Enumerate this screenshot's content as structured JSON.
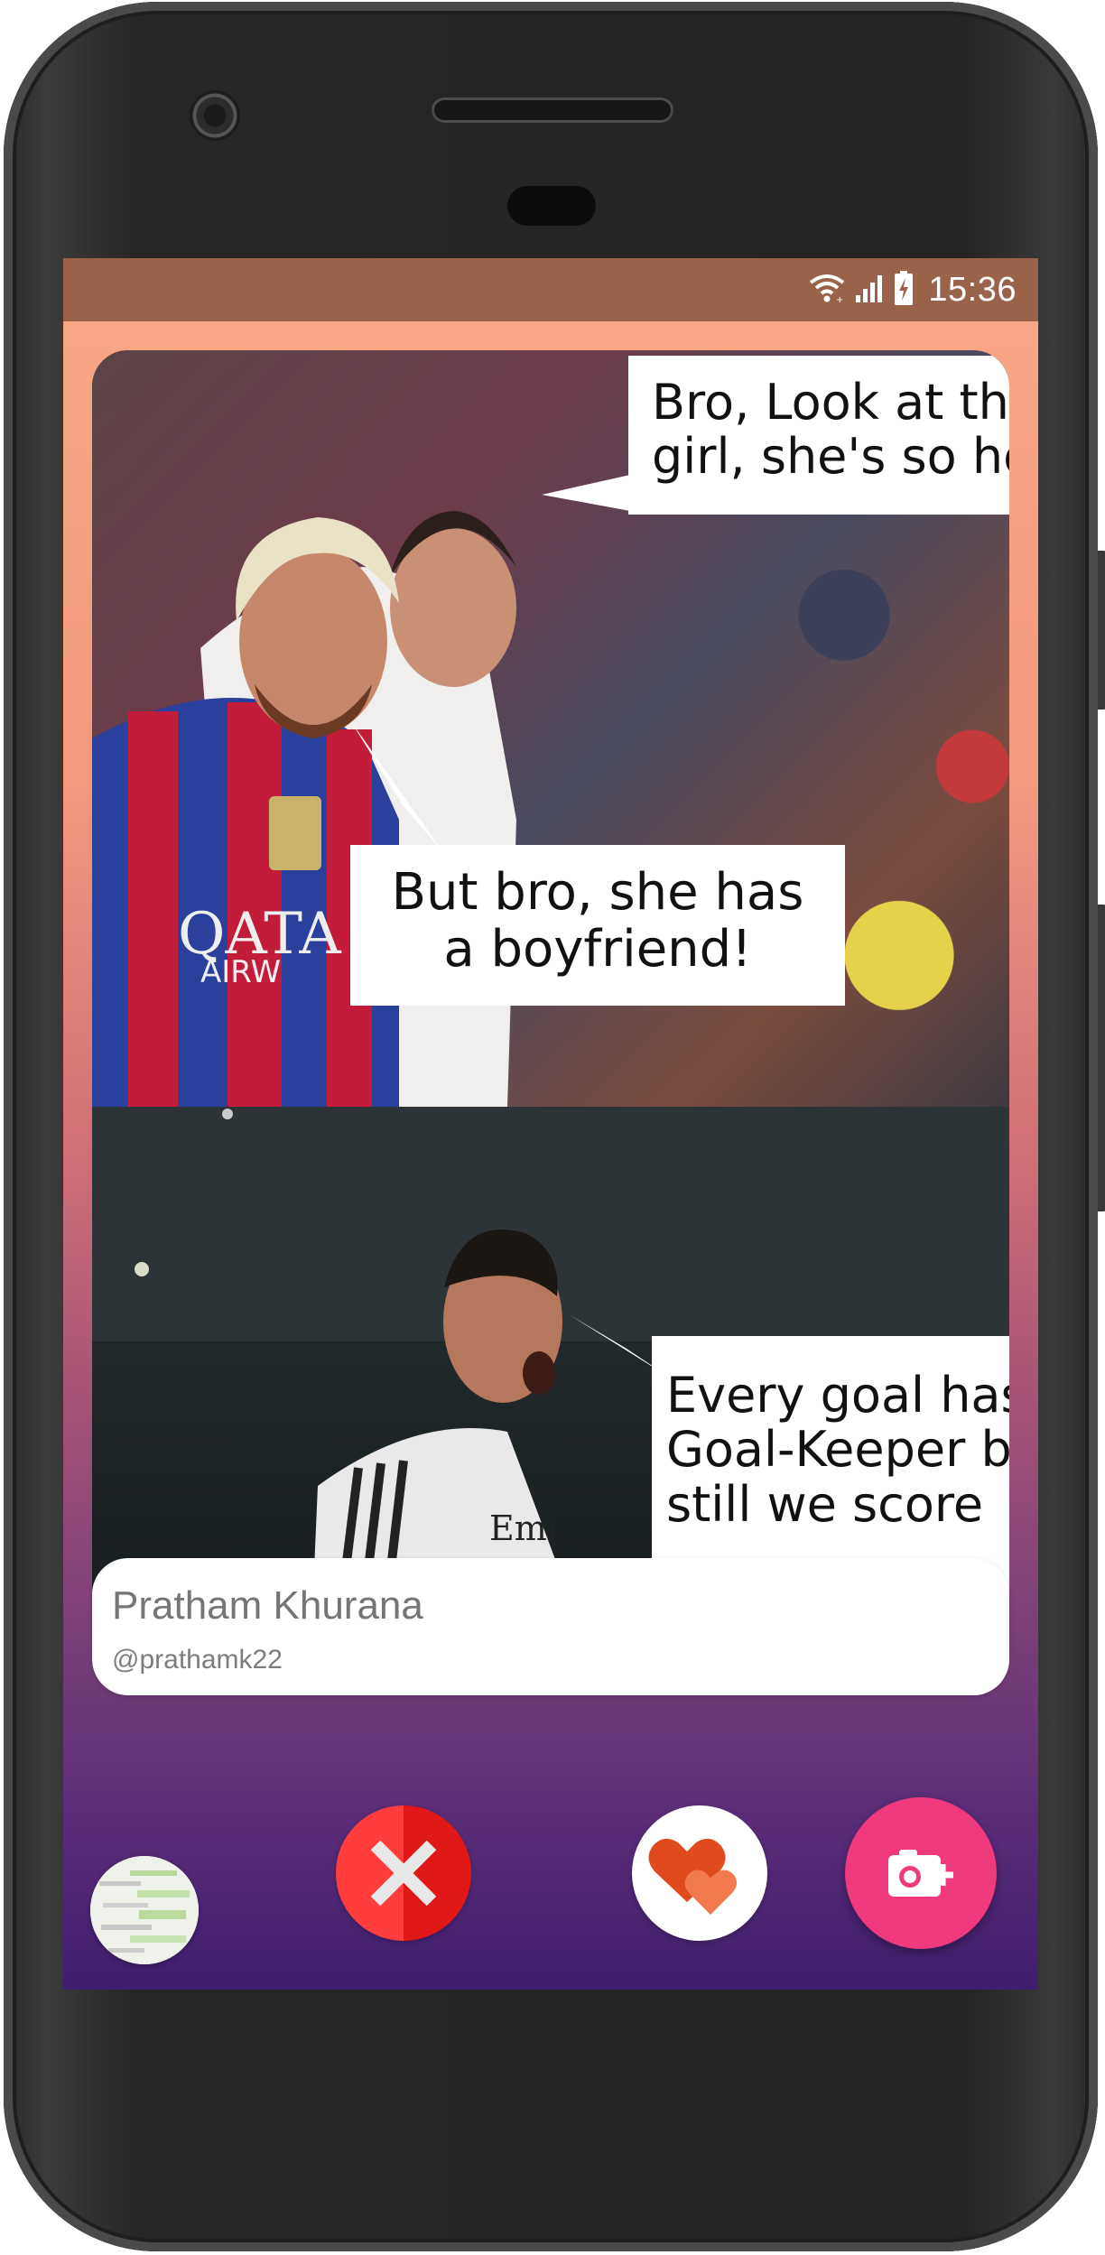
{
  "status_bar": {
    "time": "15:36",
    "icons": [
      "wifi-icon",
      "signal-icon",
      "battery-charging-icon"
    ]
  },
  "post": {
    "caption_1": "Bro, Look at th\ngirl, she's so ho",
    "caption_2": "But bro, she has\na boyfriend!",
    "caption_3": "Every goal has\nGoal-Keeper bu\nstill we score"
  },
  "profile": {
    "name": "Pratham Khurana",
    "handle": "@prathamk22"
  },
  "actions": {
    "dislike_icon": "close-icon",
    "like_icon": "hearts-icon",
    "camera_icon": "add-photo-icon"
  },
  "colors": {
    "status_bar": "#9a6248",
    "dislike": "#ff3d3d",
    "camera_fab": "#ef3a7e",
    "heart": "#f05a28"
  }
}
